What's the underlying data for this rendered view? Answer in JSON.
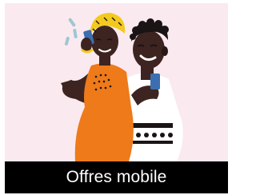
{
  "tile": {
    "caption": "Offres mobile"
  },
  "illustration": {
    "subject": "two-people-using-phones",
    "colors": {
      "background": "#fbe9f0",
      "caption_bar": "#000000",
      "caption_text": "#ffffff",
      "skin": "#3d2420",
      "skin_shadow": "#2a1714",
      "headwrap": "#f4c91e",
      "dress": "#ee7a1a",
      "shirt": "#ffffff",
      "phone": "#3c6fb0",
      "hair": "#1a1414"
    }
  }
}
